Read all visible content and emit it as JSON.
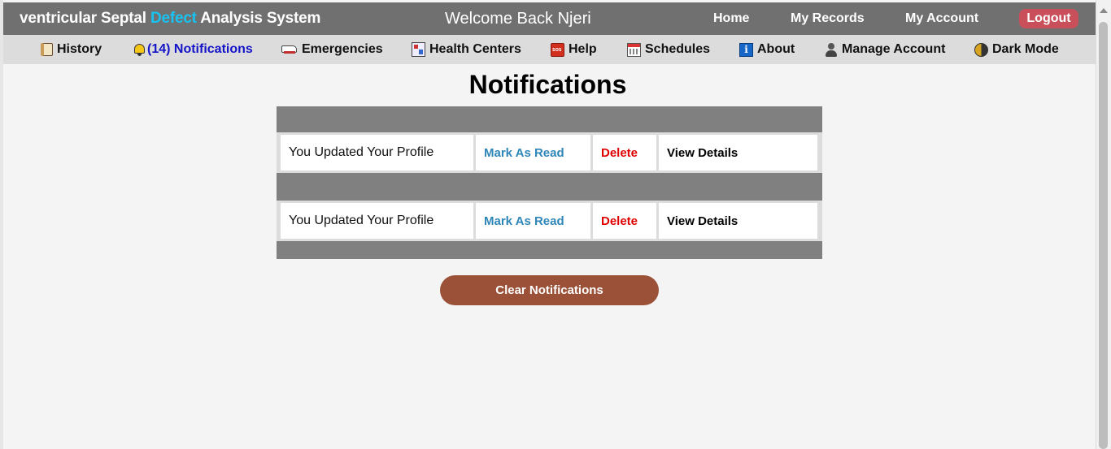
{
  "header": {
    "brand_part1": "ventricular Septal ",
    "brand_accent": "Defect",
    "brand_part2": " Analysis System",
    "welcome": "Welcome Back Njeri",
    "links": {
      "home": "Home",
      "records": "My Records",
      "account": "My Account"
    },
    "logout": "Logout"
  },
  "nav": {
    "history": "History",
    "notifications": "(14) Notifications",
    "emergencies": "Emergencies",
    "health_centers": "Health Centers",
    "help": "Help",
    "schedules": "Schedules",
    "about": "About",
    "manage_account": "Manage Account",
    "dark_mode": "Dark Mode"
  },
  "page": {
    "title": "Notifications"
  },
  "notifications": [
    {
      "message": "You Updated Your Profile",
      "mark_read": "Mark As Read",
      "delete": "Delete",
      "view": "View Details"
    },
    {
      "message": "You Updated Your Profile",
      "mark_read": "Mark As Read",
      "delete": "Delete",
      "view": "View Details"
    }
  ],
  "actions": {
    "clear": "Clear Notifications"
  },
  "colors": {
    "topbar": "#707070",
    "navbar": "#dcdcdc",
    "brand_accent": "#17c3f2",
    "logout": "#c9505a",
    "active_nav": "#1414c8",
    "mark_read": "#2f86b8",
    "delete": "#e00000",
    "clear_button": "#9a5138"
  },
  "icons": {
    "history": "scroll-icon",
    "notifications": "bell-icon",
    "emergencies": "ambulance-icon",
    "health_centers": "hospital-icon",
    "help": "sos-icon",
    "schedules": "calendar-icon",
    "about": "info-icon",
    "manage_account": "user-icon",
    "dark_mode": "moon-icon"
  }
}
